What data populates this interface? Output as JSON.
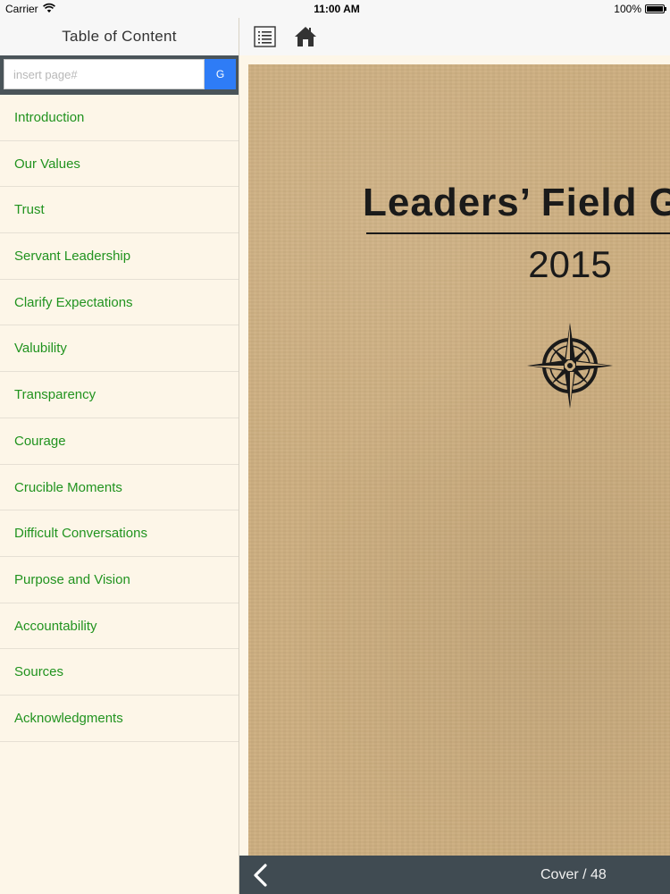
{
  "status_bar": {
    "carrier": "Carrier",
    "time": "11:00 AM",
    "battery": "100%"
  },
  "sidebar": {
    "title": "Table of Content",
    "search": {
      "placeholder": "insert page#",
      "value": "",
      "button_label": "G"
    },
    "items": [
      {
        "label": "Introduction"
      },
      {
        "label": "Our Values"
      },
      {
        "label": "Trust"
      },
      {
        "label": "Servant Leadership"
      },
      {
        "label": "Clarify Expectations"
      },
      {
        "label": "Valubility"
      },
      {
        "label": "Transparency"
      },
      {
        "label": "Courage"
      },
      {
        "label": "Crucible Moments"
      },
      {
        "label": "Difficult Conversations"
      },
      {
        "label": "Purpose and Vision"
      },
      {
        "label": "Accountability"
      },
      {
        "label": "Sources"
      },
      {
        "label": "Acknowledgments"
      }
    ]
  },
  "toolbar": {
    "icons": [
      "list-icon",
      "home-icon"
    ]
  },
  "book": {
    "title": "Leaders’ Field G",
    "year": "2015",
    "emblem": "compass-icon"
  },
  "bottom_bar": {
    "page_indicator": "Cover / 48",
    "back_icon": "chevron-left-icon"
  },
  "colors": {
    "link_green": "#21931f",
    "go_button_blue": "#2e7cf6",
    "sidebar_bg": "#fdf6e8",
    "search_bar_bg": "#4a5459",
    "bottom_bar_bg": "#404b52",
    "cover_tan": "#cdae80"
  }
}
